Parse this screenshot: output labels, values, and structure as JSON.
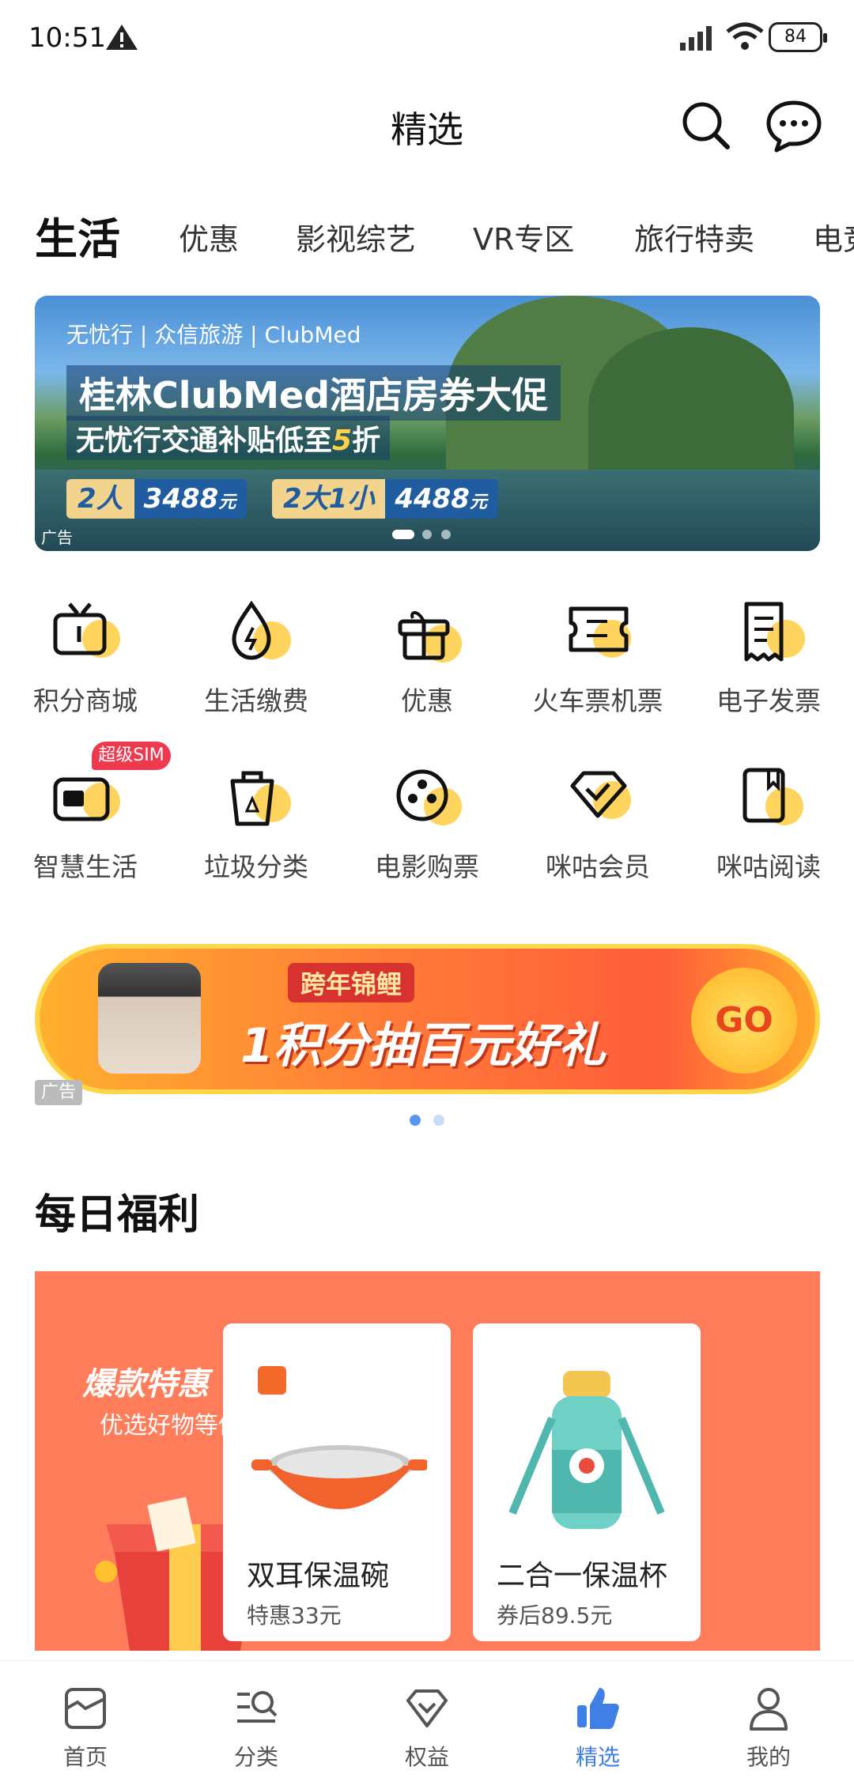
{
  "status_bar": {
    "time": "10:51",
    "battery": "84"
  },
  "header": {
    "title": "精选"
  },
  "tabs": [
    {
      "label": "生活",
      "active": true
    },
    {
      "label": "优惠"
    },
    {
      "label": "影视综艺"
    },
    {
      "label": "VR专区"
    },
    {
      "label": "旅行特卖"
    },
    {
      "label": "电竞"
    }
  ],
  "banner": {
    "brand": "无忧行 | 众信旅游 | ClubMed",
    "headline": "桂林ClubMed酒店房券大促",
    "sub_prefix": "无忧行交通补贴低至",
    "sub_highlight": "5",
    "sub_suffix": "折",
    "price1_who": "2人",
    "price1_value": "3488",
    "price2_who": "2大1小",
    "price2_value": "4488",
    "price_unit": "元",
    "ad_label": "广告"
  },
  "grid": [
    {
      "label": "积分商城",
      "icon": "tv-icon"
    },
    {
      "label": "生活缴费",
      "icon": "water-drop-bolt-icon"
    },
    {
      "label": "优惠",
      "icon": "gift-box-icon"
    },
    {
      "label": "火车票机票",
      "icon": "ticket-icon"
    },
    {
      "label": "电子发票",
      "icon": "receipt-icon"
    },
    {
      "label": "智慧生活",
      "icon": "sim-card-icon"
    },
    {
      "label": "垃圾分类",
      "icon": "recycle-bin-icon"
    },
    {
      "label": "电影购票",
      "icon": "film-reel-icon"
    },
    {
      "label": "咪咕会员",
      "icon": "diamond-check-icon"
    },
    {
      "label": "咪咕阅读",
      "icon": "book-icon"
    }
  ],
  "sim_badge": "超级SIM",
  "promo": {
    "tag": "跨年锦鲤",
    "main": "1积分抽百元好礼",
    "go": "GO",
    "ad_label": "广告"
  },
  "daily": {
    "title": "每日福利",
    "hot_title": "爆款特惠",
    "hot_sub": "优选好物等你抢",
    "items": [
      {
        "name": "双耳保温碗",
        "price": "特惠33元"
      },
      {
        "name": "二合一保温杯",
        "price": "券后89.5元"
      }
    ]
  },
  "nav": [
    {
      "label": "首页",
      "icon": "home-icon"
    },
    {
      "label": "分类",
      "icon": "category-search-icon"
    },
    {
      "label": "权益",
      "icon": "diamond-icon"
    },
    {
      "label": "精选",
      "icon": "thumbs-up-icon",
      "active": true
    },
    {
      "label": "我的",
      "icon": "person-icon"
    }
  ],
  "colors": {
    "accent": "#3f7fe6",
    "icon_yellow": "#ffd45e",
    "daily_bg": "#ff7d5b"
  }
}
